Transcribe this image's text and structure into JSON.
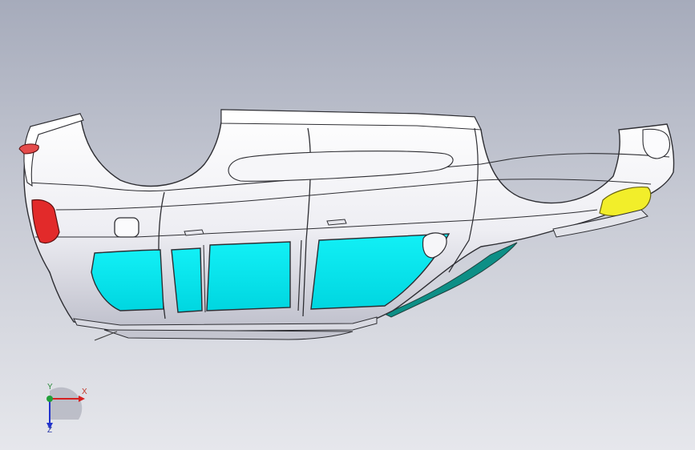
{
  "viewport": {
    "background_top": "#a6abbb",
    "background_bottom": "#e6e7ec"
  },
  "model": {
    "body_color": "#f2f2f6",
    "outline_color": "#2e2e33",
    "glass_color": "#00e8ef",
    "underbody_color": "#0d8f86",
    "tail_lamp_color": "#e22a2a",
    "fog_lamp_color": "#f2ee2a"
  },
  "triad": {
    "x_label": "X",
    "y_label": "Y",
    "z_label": "Z",
    "x_color": "#d62020",
    "y_color": "#22a03a",
    "z_color": "#2233cc",
    "icon": "coordinate-triad-icon"
  }
}
